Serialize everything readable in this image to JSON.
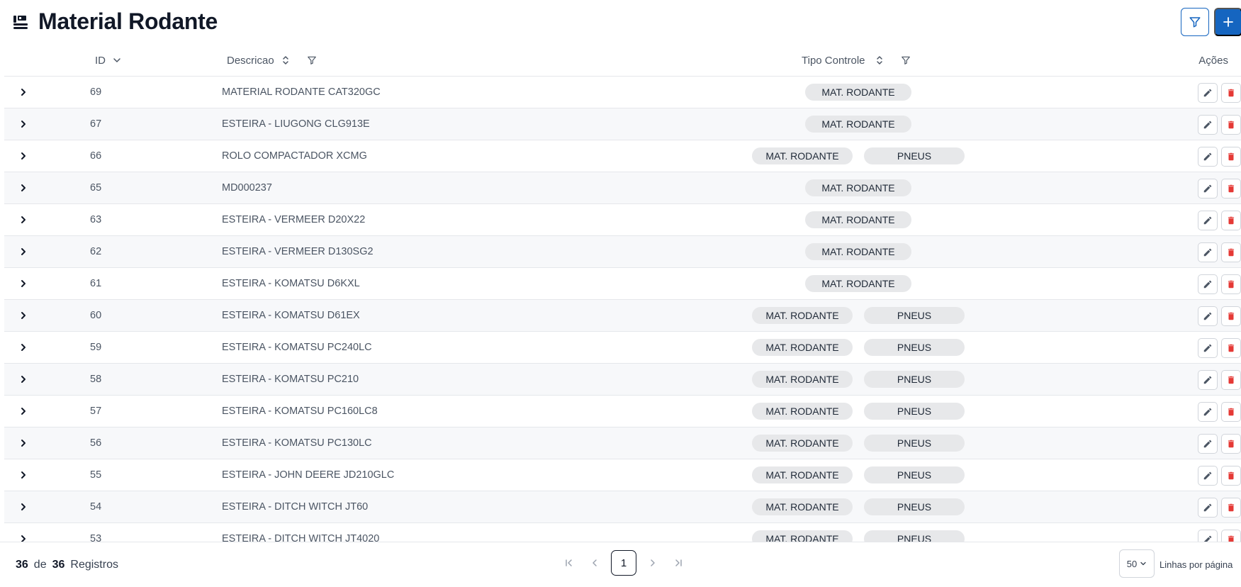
{
  "header": {
    "title": "Material Rodante",
    "icon": "machine-icon",
    "accent_color": "#1565c0"
  },
  "table": {
    "columns": {
      "id": "ID",
      "descricao": "Descricao",
      "tipo_controle": "Tipo Controle",
      "acoes": "Ações"
    },
    "rows": [
      {
        "id": "69",
        "descricao": "MATERIAL RODANTE CAT320GC",
        "tags": [
          "MAT. RODANTE"
        ]
      },
      {
        "id": "67",
        "descricao": "ESTEIRA - LIUGONG CLG913E",
        "tags": [
          "MAT. RODANTE"
        ]
      },
      {
        "id": "66",
        "descricao": "ROLO COMPACTADOR XCMG",
        "tags": [
          "MAT. RODANTE",
          "PNEUS"
        ]
      },
      {
        "id": "65",
        "descricao": "MD000237",
        "tags": [
          "MAT. RODANTE"
        ]
      },
      {
        "id": "63",
        "descricao": "ESTEIRA - VERMEER D20X22",
        "tags": [
          "MAT. RODANTE"
        ]
      },
      {
        "id": "62",
        "descricao": "ESTEIRA - VERMEER D130SG2",
        "tags": [
          "MAT. RODANTE"
        ]
      },
      {
        "id": "61",
        "descricao": "ESTEIRA - KOMATSU D6KXL",
        "tags": [
          "MAT. RODANTE"
        ]
      },
      {
        "id": "60",
        "descricao": "ESTEIRA - KOMATSU D61EX",
        "tags": [
          "MAT. RODANTE",
          "PNEUS"
        ]
      },
      {
        "id": "59",
        "descricao": "ESTEIRA - KOMATSU PC240LC",
        "tags": [
          "MAT. RODANTE",
          "PNEUS"
        ]
      },
      {
        "id": "58",
        "descricao": "ESTEIRA - KOMATSU PC210",
        "tags": [
          "MAT. RODANTE",
          "PNEUS"
        ]
      },
      {
        "id": "57",
        "descricao": "ESTEIRA - KOMATSU PC160LC8",
        "tags": [
          "MAT. RODANTE",
          "PNEUS"
        ]
      },
      {
        "id": "56",
        "descricao": "ESTEIRA - KOMATSU PC130LC",
        "tags": [
          "MAT. RODANTE",
          "PNEUS"
        ]
      },
      {
        "id": "55",
        "descricao": "ESTEIRA - JOHN DEERE JD210GLC",
        "tags": [
          "MAT. RODANTE",
          "PNEUS"
        ]
      },
      {
        "id": "54",
        "descricao": "ESTEIRA - DITCH WITCH JT60",
        "tags": [
          "MAT. RODANTE",
          "PNEUS"
        ]
      },
      {
        "id": "53",
        "descricao": "ESTEIRA - DITCH WITCH JT4020",
        "tags": [
          "MAT. RODANTE",
          "PNEUS"
        ]
      }
    ],
    "delete_color": "#e53935"
  },
  "footer": {
    "shown": "36",
    "of_label": "de",
    "total": "36",
    "records_label": "Registros",
    "current_page": "1",
    "rows_per_page": "50",
    "rows_per_page_label": "Linhas por página"
  }
}
